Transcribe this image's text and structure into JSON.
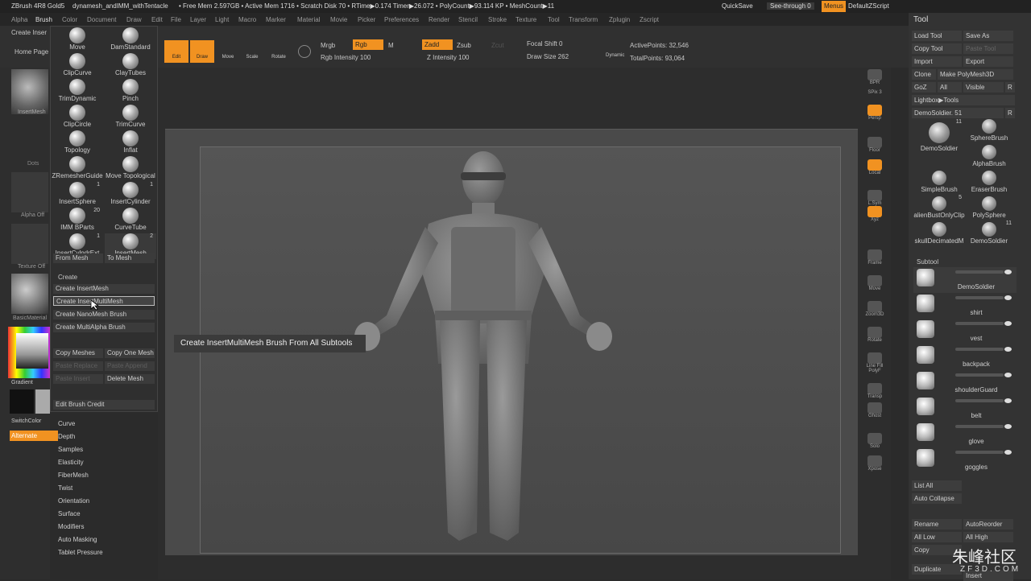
{
  "titlebar": {
    "app": "ZBrush 4R8 Gold5",
    "doc": "dynamesh_andIMM_withTentacle",
    "stats": "• Free Mem 2.597GB • Active Mem 1716 • Scratch Disk 70 • RTime▶0.174 Timer▶26.072 • PolyCount▶93.114 KP • MeshCount▶11",
    "quicksave": "QuickSave",
    "seethrough": "See-through  0",
    "menus": "Menus",
    "script": "DefaultZScript"
  },
  "menubar": [
    "Alpha",
    "Brush",
    "Color",
    "Document",
    "Draw",
    "Edit",
    "File",
    "Layer",
    "Light",
    "Macro",
    "Marker",
    "Material",
    "Movie",
    "Picker",
    "Preferences",
    "Render",
    "Stencil",
    "Stroke",
    "Texture",
    "Tool",
    "Transform",
    "Zplugin",
    "Zscript"
  ],
  "shelf": {
    "create_insert": "Create Inser",
    "home": "Home Page",
    "edit": "Edit",
    "draw": "Draw",
    "move": "Move",
    "scale": "Scale",
    "rotate": "Rotate",
    "mrgb": "Mrgb",
    "rgb": "Rgb",
    "m": "M",
    "rgb_intensity": "Rgb Intensity 100",
    "zadd": "Zadd",
    "zsub": "Zsub",
    "zcut": "Zcut",
    "z_intensity": "Z Intensity 100",
    "focal_shift": "Focal Shift 0",
    "draw_size": "Draw Size 262",
    "dynamic": "Dynamic",
    "active_points": "ActivePoints: 32,546",
    "total_points": "TotalPoints: 93,064"
  },
  "left": {
    "insertmesh": "InsertMesh",
    "dots": "Dots",
    "alpha_off": "Alpha Off",
    "texture_off": "Texture Off",
    "basic_material": "BasicMaterial",
    "gradient": "Gradient",
    "switch_color": "SwitchColor",
    "alternate": "Alternate"
  },
  "brushes": [
    {
      "name": "Move",
      "count": ""
    },
    {
      "name": "DamStandard",
      "count": ""
    },
    {
      "name": "ClipCurve",
      "count": ""
    },
    {
      "name": "ClayTubes",
      "count": ""
    },
    {
      "name": "TrimDynamic",
      "count": ""
    },
    {
      "name": "Pinch",
      "count": ""
    },
    {
      "name": "ClipCircle",
      "count": ""
    },
    {
      "name": "TrimCurve",
      "count": ""
    },
    {
      "name": "Topology",
      "count": ""
    },
    {
      "name": "Inflat",
      "count": ""
    },
    {
      "name": "ZRemesherGuide",
      "count": ""
    },
    {
      "name": "Move Topological",
      "count": ""
    },
    {
      "name": "InsertSphere",
      "count": "1"
    },
    {
      "name": "InsertCylinder",
      "count": "1"
    },
    {
      "name": "IMM BParts",
      "count": "20"
    },
    {
      "name": "CurveTube",
      "count": ""
    },
    {
      "name": "InsertCylndrExt",
      "count": "1"
    },
    {
      "name": "InsertMesh",
      "count": "2"
    }
  ],
  "brushpanel": {
    "from_mesh": "From Mesh",
    "to_mesh": "To Mesh",
    "create_header": "Create",
    "create_insertmesh": "Create InsertMesh",
    "create_insertmultimesh": "Create InsertMultiMesh",
    "create_nanomesh": "Create NanoMesh Brush",
    "create_multialpha": "Create MultiAlpha Brush",
    "copy_meshes": "Copy Meshes",
    "copy_one_mesh": "Copy One Mesh",
    "paste_replace": "Paste Replace",
    "paste_append": "Paste Append",
    "paste_insert": "Paste Insert",
    "delete_mesh": "Delete Mesh",
    "edit_brush_credit": "Edit Brush Credit"
  },
  "submenu": [
    "Curve",
    "Depth",
    "Samples",
    "Elasticity",
    "FiberMesh",
    "Twist",
    "Orientation",
    "Surface",
    "Modifiers",
    "Auto Masking",
    "Tablet Pressure"
  ],
  "tooltip": "Create InsertMultiMesh Brush From All Subtools",
  "rightshelf": [
    {
      "label": "BPR"
    },
    {
      "label": "SPix 3"
    },
    {
      "label": "Persp"
    },
    {
      "label": "Floor"
    },
    {
      "label": "Local"
    },
    {
      "label": "L.Sym"
    },
    {
      "label": "Xyz"
    },
    {
      "label": "Frame"
    },
    {
      "label": "Move"
    },
    {
      "label": "Zoom3D"
    },
    {
      "label": "Rotate"
    },
    {
      "label": "Line Fill PolyF"
    },
    {
      "label": "Transp"
    },
    {
      "label": "Ghost"
    },
    {
      "label": "Solo"
    },
    {
      "label": "Xpose"
    }
  ],
  "tool": {
    "header": "Tool",
    "load": "Load Tool",
    "save": "Save As",
    "copy": "Copy Tool",
    "paste": "Paste Tool",
    "import": "Import",
    "export": "Export",
    "clone": "Clone",
    "make_polymesh": "Make PolyMesh3D",
    "goz": "GoZ",
    "all": "All",
    "visible": "Visible",
    "r": "R",
    "lightbox": "Lightbox▶Tools",
    "demosoldier_slider": "DemoSoldier. 51",
    "r2": "R",
    "thumbs": [
      {
        "name": "DemoSoldier",
        "count": "11"
      },
      {
        "name": "SphereBrush",
        "count": ""
      },
      {
        "name": "AlphaBrush",
        "count": ""
      },
      {
        "name": "SimpleBrush",
        "count": ""
      },
      {
        "name": "EraserBrush",
        "count": ""
      },
      {
        "name": "alienBustOnlyClip",
        "count": "5"
      },
      {
        "name": "PolySphere",
        "count": ""
      },
      {
        "name": "skullDecimatedM",
        "count": ""
      },
      {
        "name": "DemoSoldier",
        "count": "11"
      }
    ],
    "subtool_header": "Subtool",
    "subtools": [
      "DemoSoldier",
      "shirt",
      "vest",
      "backpack",
      "shoulderGuard",
      "belt",
      "glove",
      "goggles"
    ],
    "list_all": "List All",
    "auto_collapse": "Auto Collapse",
    "rename": "Rename",
    "auto_reorder": "AutoReorder",
    "all_low": "All Low",
    "all_high": "All High",
    "copy2": "Copy",
    "duplicate": "Duplicate",
    "insert": "Insert"
  },
  "watermark": "朱峰社区",
  "watermark_url": "ZF3D.COM"
}
